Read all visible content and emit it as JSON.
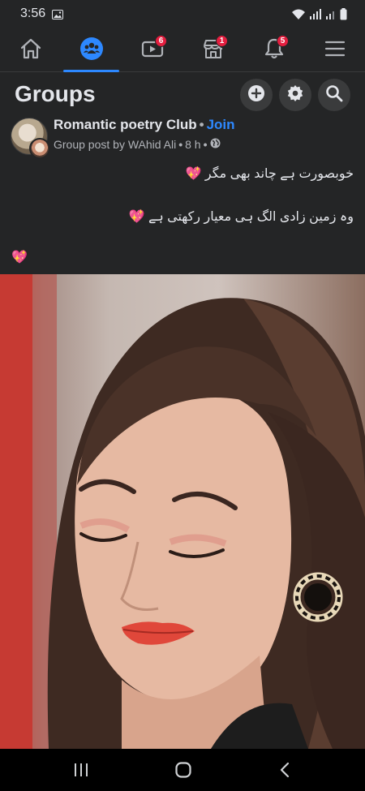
{
  "status_bar": {
    "time": "3:56"
  },
  "nav": {
    "items": [
      {
        "name": "home"
      },
      {
        "name": "groups",
        "active": true
      },
      {
        "name": "watch",
        "badge": "6"
      },
      {
        "name": "marketplace",
        "badge": "1"
      },
      {
        "name": "notifications",
        "badge": "5"
      },
      {
        "name": "menu"
      }
    ]
  },
  "header": {
    "title": "Groups"
  },
  "post": {
    "group_name": "Romantic poetry Club",
    "separator": "•",
    "join_label": "Join",
    "meta_prefix": "Group post by WAhid Ali",
    "meta_time": "8 h",
    "lines": [
      "خوبصورت ہے چاند بھی مگر 💖",
      "وہ زمین زادی الگ ہی معیار رکھتی ہے 💖",
      "💖"
    ]
  },
  "colors": {
    "background": "#242526",
    "accent": "#2d88ff",
    "badge": "#e41e3f"
  }
}
